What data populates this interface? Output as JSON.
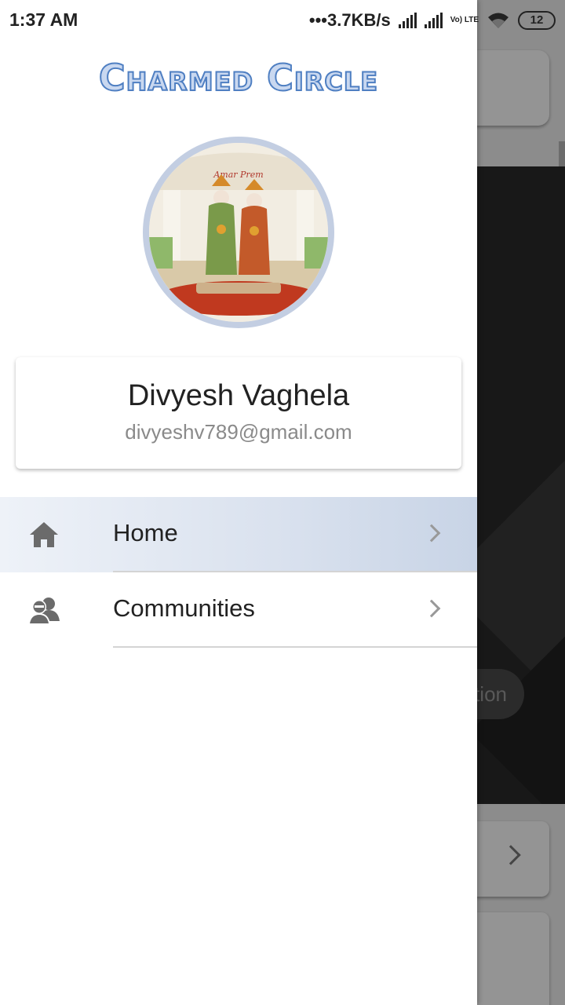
{
  "status_bar": {
    "time": "1:37 AM",
    "network_speed": "•••3.7KB/s",
    "volte_label": "Vo) LTE",
    "battery_level": "12"
  },
  "drawer": {
    "logo_text": "Charmed Circle",
    "avatar_caption": "Amar Prem",
    "user": {
      "name": "Divyesh Vaghela",
      "email": "divyeshv789@gmail.com"
    },
    "menu": [
      {
        "label": "Home",
        "icon": "home-icon",
        "selected": true
      },
      {
        "label": "Communities",
        "icon": "communities-icon",
        "selected": false
      }
    ]
  },
  "background": {
    "pill_text": "tion"
  },
  "colors": {
    "accent": "#4f7fc2",
    "selected_item": "#c8d4e6",
    "avatar_ring": "#c3cee2"
  }
}
